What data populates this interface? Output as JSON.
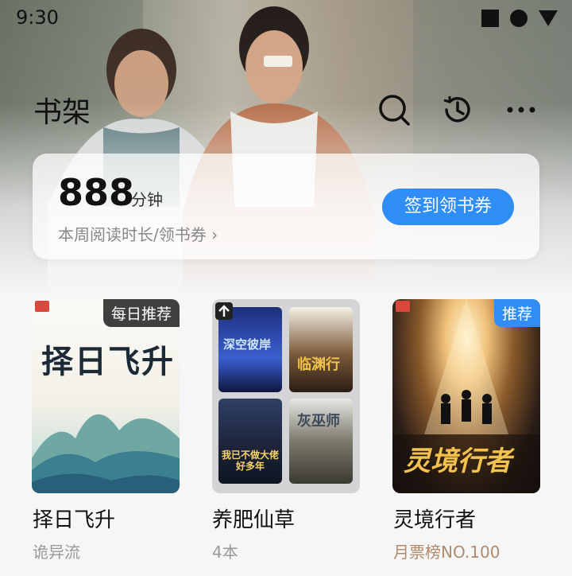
{
  "status": {
    "time": "9:30"
  },
  "header": {
    "title": "书架"
  },
  "toolbar": {
    "icons": [
      "search-icon",
      "history-icon",
      "more-icon"
    ]
  },
  "reading_card": {
    "minutes": "888",
    "unit": "分钟",
    "subtitle": "本周阅读时长/领书券 ›",
    "button": "签到领书券"
  },
  "books": [
    {
      "badge": "每日推荐",
      "cover_text": "择日飞升",
      "title": "择日飞升",
      "subtitle": "诡异流"
    },
    {
      "title": "养肥仙草",
      "subtitle": "4本",
      "stack": [
        "深空彼岸",
        "临渊行",
        "我已不做大佬好多年",
        "灰巫师"
      ]
    },
    {
      "badge": "推荐",
      "cover_text": "灵境行者",
      "title": "灵境行者",
      "subtitle": "月票榜NO.100"
    }
  ],
  "colors": {
    "accent": "#2f8ef5",
    "rank": "#b08a6a"
  }
}
